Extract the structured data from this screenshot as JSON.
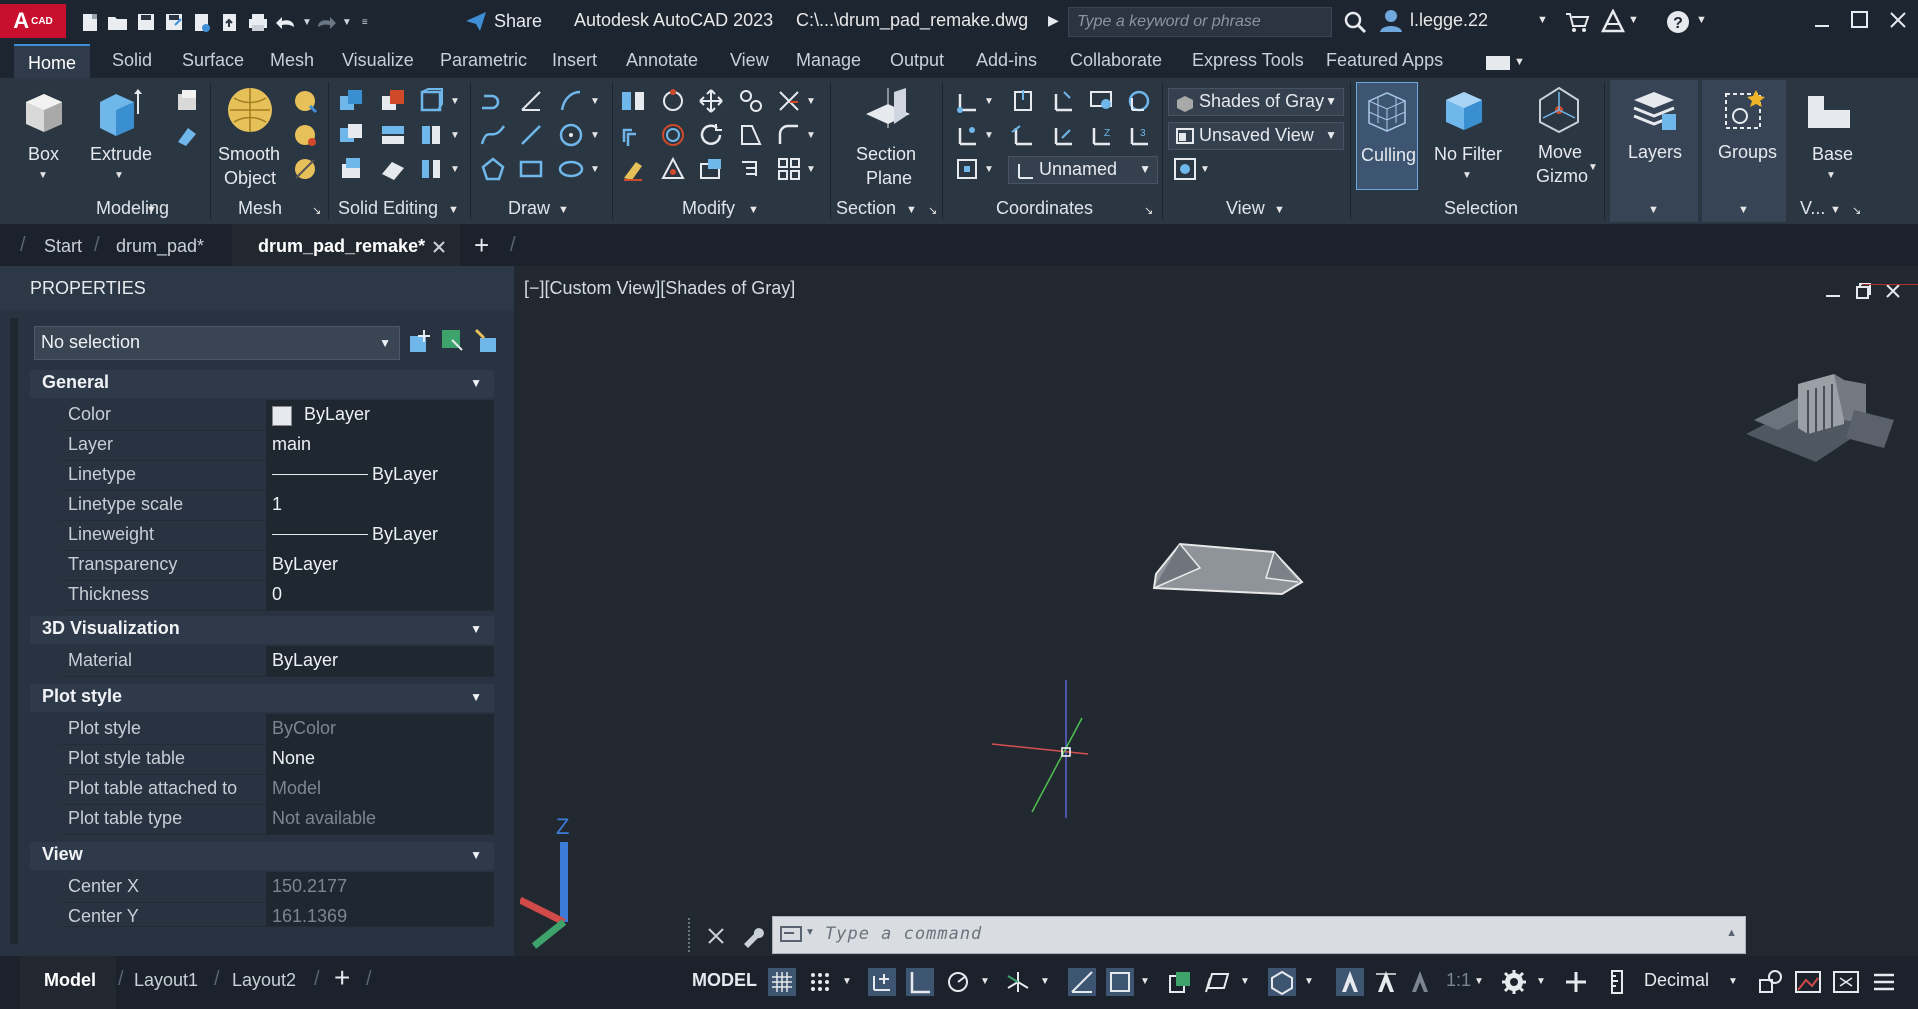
{
  "app": {
    "logo_letter": "A",
    "logo_sub": "CAD",
    "title": "Autodesk AutoCAD 2023",
    "file_path": "C:\\...\\drum_pad_remake.dwg",
    "share_label": "Share",
    "search_placeholder": "Type a keyword or phrase",
    "user": "l.legge.22"
  },
  "ribbon_tabs": [
    "Home",
    "Solid",
    "Surface",
    "Mesh",
    "Visualize",
    "Parametric",
    "Insert",
    "Annotate",
    "View",
    "Manage",
    "Output",
    "Add-ins",
    "Collaborate",
    "Express Tools",
    "Featured Apps"
  ],
  "ribbon": {
    "box": "Box",
    "extrude": "Extrude",
    "smooth_object_1": "Smooth",
    "smooth_object_2": "Object",
    "section_plane_1": "Section",
    "section_plane_2": "Plane",
    "visual_style": "Shades of Gray",
    "named_view": "Unsaved View",
    "ucs": "Unnamed",
    "culling": "Culling",
    "no_filter": "No Filter",
    "move_gizmo_1": "Move",
    "move_gizmo_2": "Gizmo",
    "layers": "Layers",
    "groups": "Groups",
    "base": "Base",
    "panels": {
      "modeling": "Modeling",
      "mesh": "Mesh",
      "solid_editing": "Solid Editing",
      "draw": "Draw",
      "modify": "Modify",
      "section": "Section",
      "coordinates": "Coordinates",
      "view": "View",
      "selection": "Selection",
      "v_truncated": "V..."
    }
  },
  "doc_tabs": {
    "start": "Start",
    "tab1": "drum_pad*",
    "tab2": "drum_pad_remake*",
    "add": "+"
  },
  "properties": {
    "header": "PROPERTIES",
    "selection": "No selection",
    "sections": {
      "general": "General",
      "viz3d": "3D Visualization",
      "plot": "Plot style",
      "view": "View"
    },
    "general": [
      {
        "k": "Color",
        "v": "ByLayer"
      },
      {
        "k": "Layer",
        "v": "main"
      },
      {
        "k": "Linetype",
        "v": "ByLayer"
      },
      {
        "k": "Linetype scale",
        "v": "1"
      },
      {
        "k": "Lineweight",
        "v": "ByLayer"
      },
      {
        "k": "Transparency",
        "v": "ByLayer"
      },
      {
        "k": "Thickness",
        "v": "0"
      }
    ],
    "viz3d": [
      {
        "k": "Material",
        "v": "ByLayer"
      }
    ],
    "plot": [
      {
        "k": "Plot style",
        "v": "ByColor"
      },
      {
        "k": "Plot style table",
        "v": "None"
      },
      {
        "k": "Plot table attached to",
        "v": "Model"
      },
      {
        "k": "Plot table type",
        "v": "Not available"
      }
    ],
    "view": [
      {
        "k": "Center X",
        "v": "150.2177"
      },
      {
        "k": "Center Y",
        "v": "161.1369"
      }
    ]
  },
  "viewport": {
    "label": "[−][Custom View][Shades of Gray]",
    "axis_z": "Z",
    "command_placeholder": "Type a command"
  },
  "statusbar": {
    "model": "Model",
    "layout1": "Layout1",
    "layout2": "Layout2",
    "add": "+",
    "model_space": "MODEL",
    "scale": "1:1",
    "units": "Decimal"
  }
}
